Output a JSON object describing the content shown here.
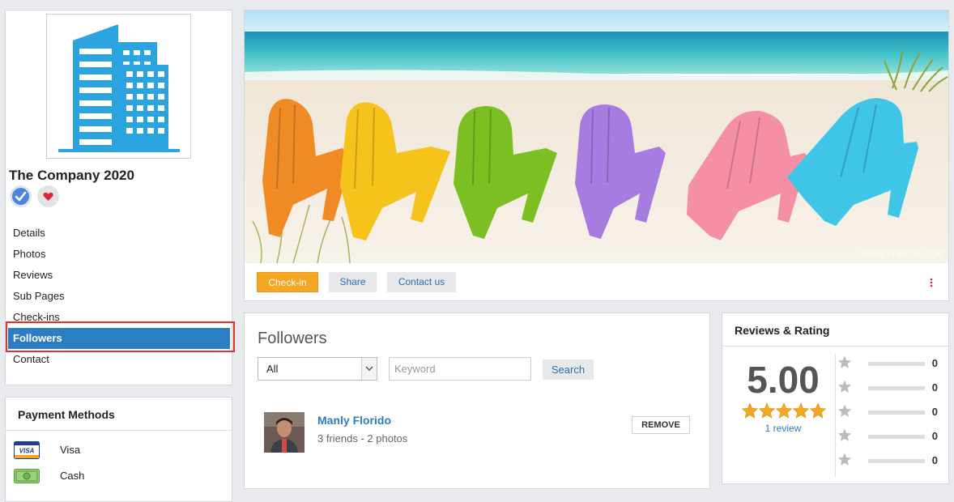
{
  "company": {
    "name": "The Company 2020"
  },
  "nav": {
    "items": [
      {
        "label": "Details",
        "active": false
      },
      {
        "label": "Photos",
        "active": false
      },
      {
        "label": "Reviews",
        "active": false
      },
      {
        "label": "Sub Pages",
        "active": false
      },
      {
        "label": "Check-ins",
        "active": false
      },
      {
        "label": "Followers",
        "active": true
      },
      {
        "label": "Contact",
        "active": false
      }
    ]
  },
  "payment": {
    "title": "Payment Methods",
    "methods": [
      {
        "label": "Visa",
        "icon": "visa-card-icon",
        "icon_text": "VISA"
      },
      {
        "label": "Cash",
        "icon": "cash-icon"
      }
    ]
  },
  "cover": {
    "watermark": "©FAMILYTIMEFUN.COM",
    "actions": {
      "checkin": "Check-in",
      "share": "Share",
      "contact": "Contact us"
    }
  },
  "followers": {
    "title": "Followers",
    "filter": {
      "selected": "All"
    },
    "search": {
      "placeholder": "Keyword",
      "button": "Search"
    },
    "list": [
      {
        "name": "Manly Florido",
        "meta": "3 friends - 2 photos",
        "action": "REMOVE"
      }
    ]
  },
  "reviews": {
    "title": "Reviews & Rating",
    "average": "5.00",
    "stars": 5,
    "count_label": "1 review",
    "breakdown": [
      {
        "stars": 5,
        "count": "0",
        "fraction": 0
      },
      {
        "stars": 4,
        "count": "0",
        "fraction": 0
      },
      {
        "stars": 3,
        "count": "0",
        "fraction": 0
      },
      {
        "stars": 2,
        "count": "0",
        "fraction": 0
      },
      {
        "stars": 1,
        "count": "0",
        "fraction": 0
      }
    ]
  },
  "colors": {
    "accent": "#2c7ec3",
    "checkin": "#f5a623",
    "highlight": "#e03030",
    "logo": "#2aa3df",
    "star": "#f5a623",
    "star_empty": "#bbbbbb"
  }
}
